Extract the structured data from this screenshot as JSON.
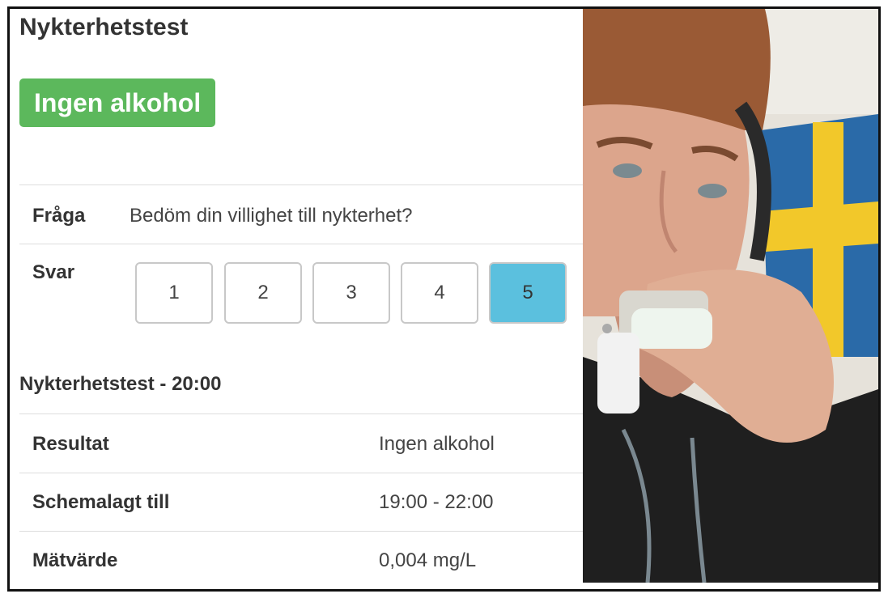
{
  "page": {
    "title": "Nykterhetstest"
  },
  "status": {
    "badge": "Ingen alkohol",
    "color": "#5cb85c"
  },
  "question": {
    "label": "Fråga",
    "text": "Bedöm din villighet till nykterhet?"
  },
  "answer": {
    "label": "Svar",
    "options": [
      "1",
      "2",
      "3",
      "4",
      "5"
    ],
    "selected": "5",
    "selected_color": "#5bc0de"
  },
  "test": {
    "title": "Nykterhetstest - 20:00",
    "rows": [
      {
        "label": "Resultat",
        "value": "Ingen alkohol"
      },
      {
        "label": "Schemalagt till",
        "value": "19:00 - 22:00"
      },
      {
        "label": "Mätvärde",
        "value": "0,004 mg/L"
      }
    ]
  },
  "photo": {
    "subject": "person blowing into breathalyzer device with Swedish flag behind"
  }
}
